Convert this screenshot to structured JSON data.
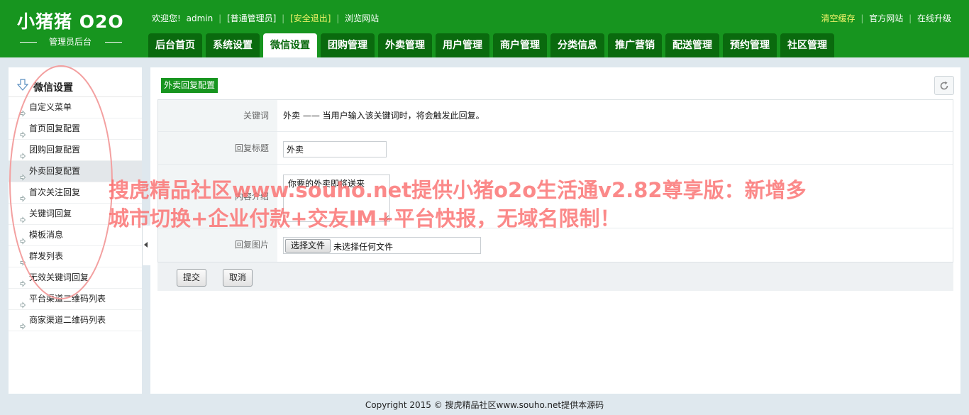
{
  "brand": {
    "title": "小猪猪 O2O",
    "subtitle": "管理员后台"
  },
  "topbar": {
    "welcome": "欢迎您!",
    "user": "admin",
    "role": "[普通管理员]",
    "logout": "[安全退出]",
    "browse": "浏览网站",
    "clear_cache": "清空缓存",
    "official_site": "官方网站",
    "upgrade": "在线升级"
  },
  "nav": {
    "tabs": [
      {
        "label": "后台首页",
        "active": false
      },
      {
        "label": "系统设置",
        "active": false
      },
      {
        "label": "微信设置",
        "active": true
      },
      {
        "label": "团购管理",
        "active": false
      },
      {
        "label": "外卖管理",
        "active": false
      },
      {
        "label": "用户管理",
        "active": false
      },
      {
        "label": "商户管理",
        "active": false
      },
      {
        "label": "分类信息",
        "active": false
      },
      {
        "label": "推广营销",
        "active": false
      },
      {
        "label": "配送管理",
        "active": false
      },
      {
        "label": "预约管理",
        "active": false
      },
      {
        "label": "社区管理",
        "active": false
      }
    ]
  },
  "sidebar": {
    "title": "微信设置",
    "items": [
      {
        "label": "自定义菜单",
        "active": false
      },
      {
        "label": "首页回复配置",
        "active": false
      },
      {
        "label": "团购回复配置",
        "active": false
      },
      {
        "label": "外卖回复配置",
        "active": true
      },
      {
        "label": "首次关注回复",
        "active": false
      },
      {
        "label": "关键词回复",
        "active": false
      },
      {
        "label": "模板消息",
        "active": false
      },
      {
        "label": "群发列表",
        "active": false
      },
      {
        "label": "无效关键词回复",
        "active": false
      },
      {
        "label": "平台渠道二维码列表",
        "active": false
      },
      {
        "label": "商家渠道二维码列表",
        "active": false
      }
    ]
  },
  "main": {
    "section_title": "外卖回复配置",
    "keyword_label": "关键词",
    "keyword_value": "外卖 —— 当用户输入该关键词时，将会触发此回复。",
    "reply_title_label": "回复标题",
    "reply_title_value": "外卖",
    "content_label": "内容介绍",
    "content_value": "你要的外卖即将送来",
    "image_label": "回复图片",
    "file_button": "选择文件",
    "file_none": "未选择任何文件",
    "submit": "提交",
    "cancel": "取消"
  },
  "watermark": {
    "text": "搜虎精品社区www.souho.net提供小猪o2o生活通v2.82尊享版：新增多城市切换+企业付款+交友IM+平台快报，无域名限制！"
  },
  "footer": {
    "copyright": "Copyright 2015 © 搜虎精品社区www.souho.net提供本源码"
  },
  "colors": {
    "header_green": "#17951f",
    "tab_dark_green": "#0a6a0e",
    "watermark_red": "#fb6c6c",
    "logout_yellow": "#f3f36a"
  }
}
